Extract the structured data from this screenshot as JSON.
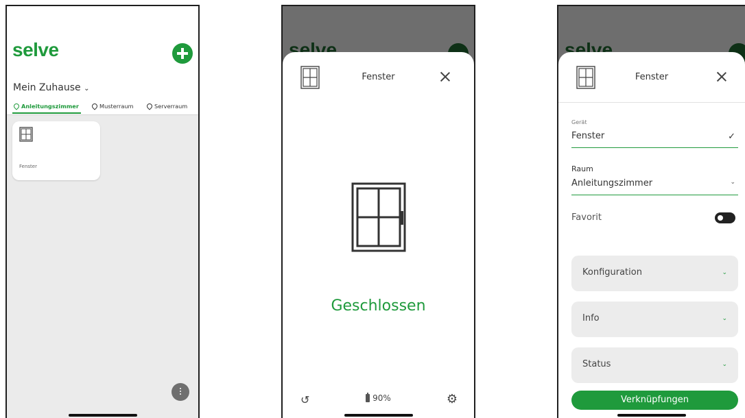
{
  "screen1": {
    "logo": "selve",
    "home_selector": "Mein Zuhause",
    "tabs": [
      {
        "label": "Anleitungszimmer",
        "active": true
      },
      {
        "label": "Musterraum",
        "active": false
      },
      {
        "label": "Serverraum",
        "active": false
      }
    ],
    "tile_label": "Fenster"
  },
  "screen2": {
    "background_logo": "selve",
    "title": "Fenster",
    "status": "Geschlossen",
    "battery": "90%"
  },
  "screen3": {
    "background_logo": "selve",
    "title": "Fenster",
    "device_label": "Gerät",
    "device_value": "Fenster",
    "room_label": "Raum",
    "room_value": "Anleitungszimmer",
    "favorite_label": "Favorit",
    "sections": [
      "Konfiguration",
      "Info",
      "Status"
    ],
    "links_button": "Verknüpfungen"
  },
  "colors": {
    "accent": "#1f9a3c",
    "overlay": "#6e6e6e",
    "tile_bg": "#ebebeb"
  },
  "icons": [
    "plus-icon",
    "chevron-down-icon",
    "location-pin-icon",
    "window-icon",
    "close-icon",
    "sync-icon",
    "battery-icon",
    "gear-icon",
    "check-icon",
    "more-icon"
  ]
}
